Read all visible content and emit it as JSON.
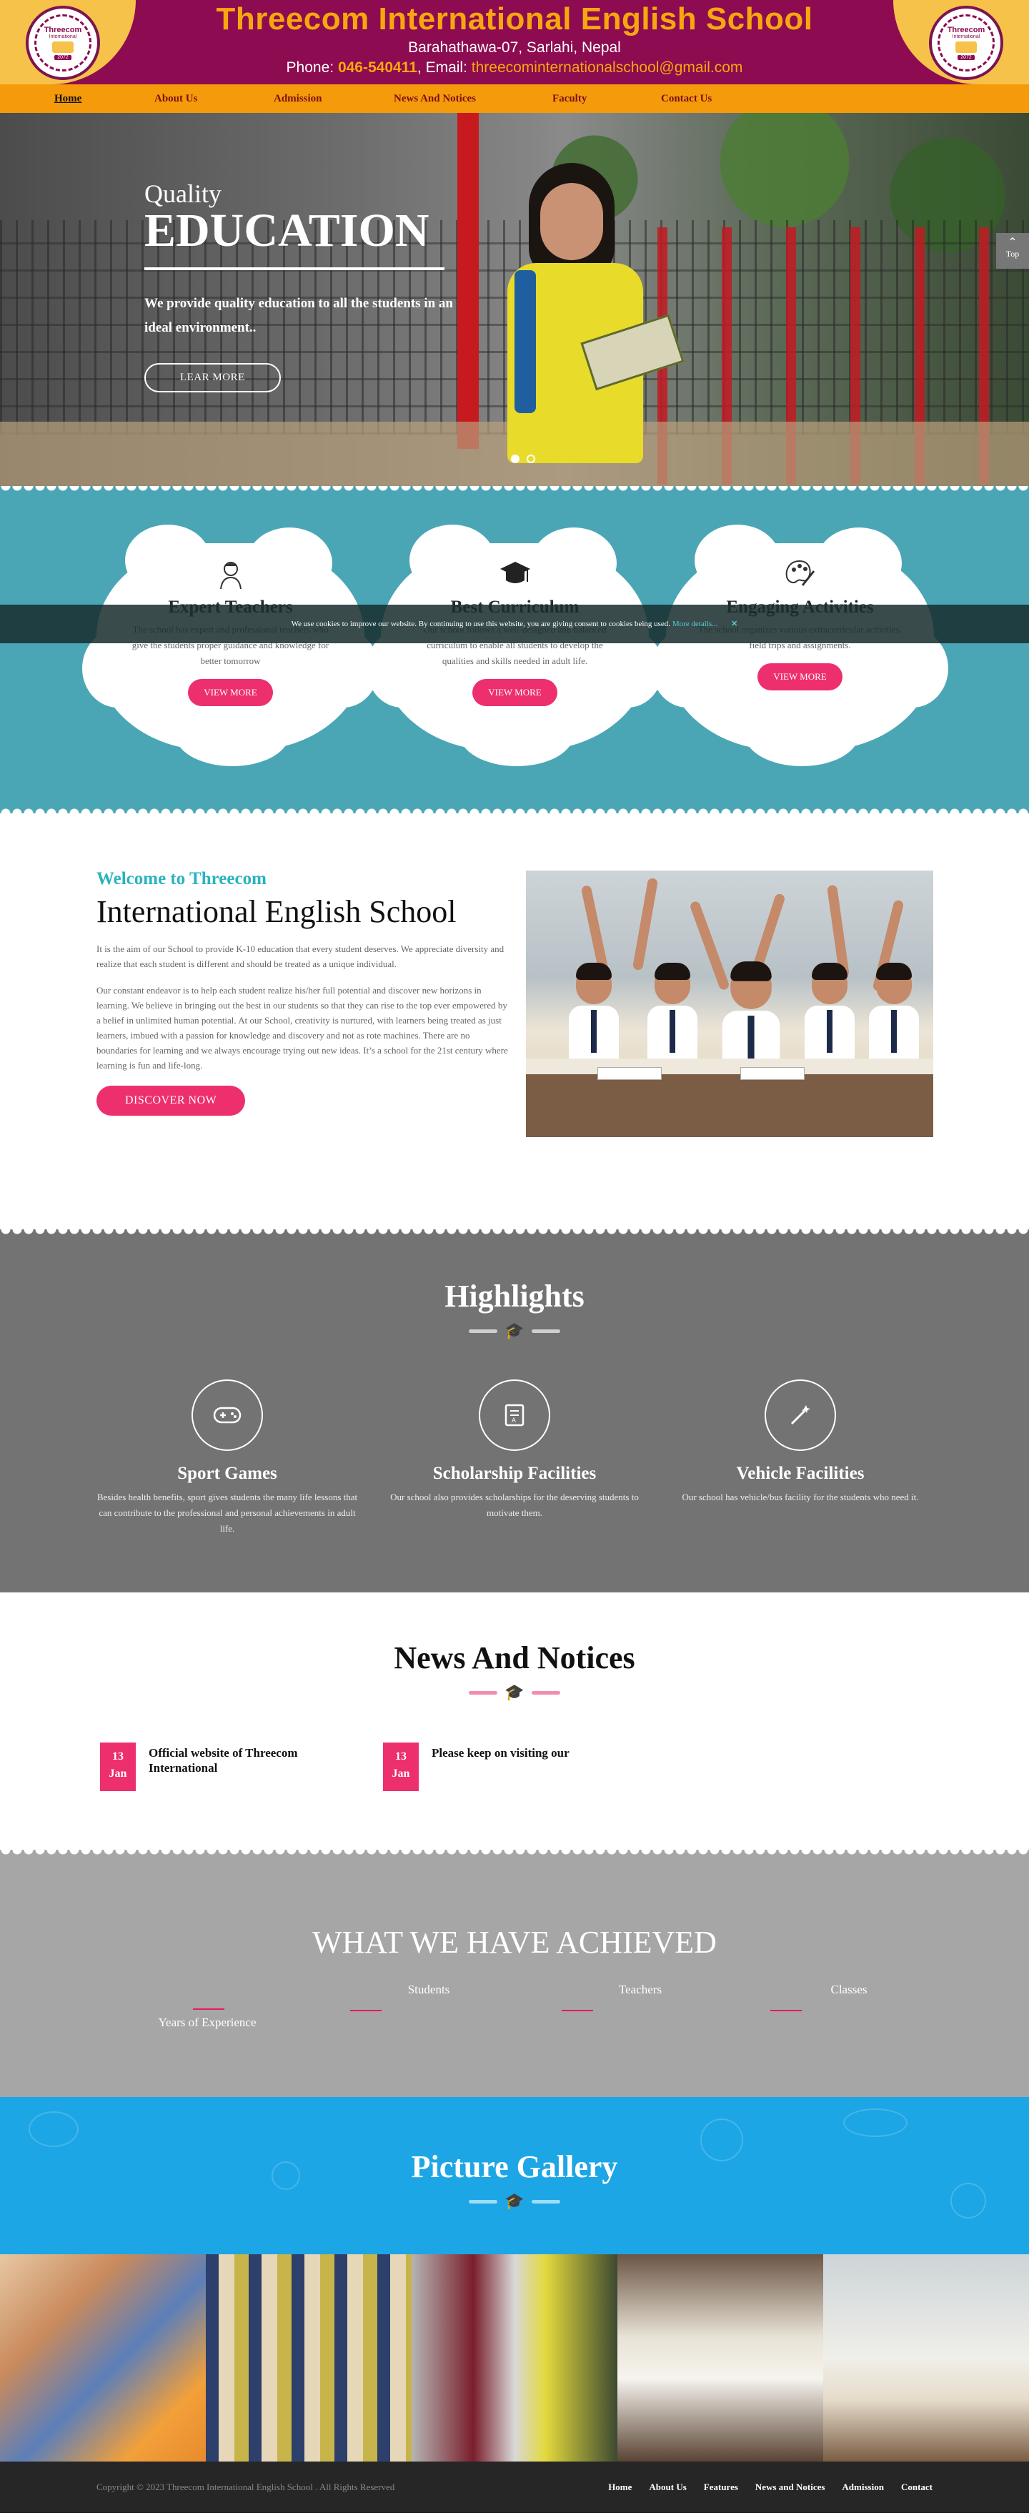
{
  "header": {
    "title": "Threecom International English School",
    "address": "Barahathawa-07, Sarlahi, Nepal",
    "phone_label": "Phone:",
    "phone": "046-540411",
    "email_label": ", Email:",
    "email": "threecominternationalschool@gmail.com",
    "logo_name": "Threecom",
    "logo_sub": "International",
    "logo_year": "2072"
  },
  "nav": [
    {
      "label": "Home",
      "active": true
    },
    {
      "label": "About Us"
    },
    {
      "label": "Admission"
    },
    {
      "label": "News And Notices"
    },
    {
      "label": "Faculty"
    },
    {
      "label": "Contact Us"
    }
  ],
  "hero": {
    "small": "Quality",
    "big": "EDUCATION",
    "desc": "We provide quality education to all the students in an ideal environment..",
    "button": "LEAR MORE",
    "top_label": "Top"
  },
  "cookie": {
    "text": "We use cookies to improve our website. By continuing to use this website, you are giving consent to cookies being used.",
    "more": "More details...",
    "close": "✕"
  },
  "features": [
    {
      "icon": "teacher-icon",
      "title": "Expert Teachers",
      "desc": "The school has expert and professional teachers who give the students proper guidance and knowledge for better tomorrow",
      "button": "VIEW MORE"
    },
    {
      "icon": "graduation-cap-icon",
      "title": "Best Curriculum",
      "desc": "Our school follows a well-designed and balanced curriculum to enable all students to develop the qualities and skills needed in adult life.",
      "button": "VIEW MORE"
    },
    {
      "icon": "palette-icon",
      "title": "Engaging Activities",
      "desc": "The school organizes various extracurricular activities, field trips and assignments.",
      "button": "VIEW MORE"
    }
  ],
  "welcome": {
    "kicker": "Welcome to Threecom",
    "title": "International English School",
    "p1": "It is the aim of our School to provide K-10 education that every student deserves. We appreciate diversity and realize that each student is different and should be treated as a unique individual.",
    "p2": "Our constant endeavor is to help each student realize his/her full potential and discover new horizons in learning. We believe in bringing out the best in our students so that they can rise to the top ever empowered by a belief in unlimited human potential. At our School, creativity is nurtured, with learners being treated as just learners, imbued with a passion for knowledge and discovery and not as rote machines. There are no boundaries for learning and we always encourage trying out new ideas. It’s a school for the 21st century where learning is fun and life-long.",
    "button": "DISCOVER NOW"
  },
  "highlights": {
    "title": "Highlights",
    "items": [
      {
        "icon": "gamepad-icon",
        "title": "Sport Games",
        "desc": "Besides health benefits, sport gives students the many life lessons that can contribute to the professional and personal achievements in adult life."
      },
      {
        "icon": "book-icon",
        "title": "Scholarship Facilities",
        "desc": "Our school also provides scholarships for the deserving students to motivate them."
      },
      {
        "icon": "magic-wand-icon",
        "title": "Vehicle Facilities",
        "desc": "Our school has vehicle/bus facility for the students who need it."
      }
    ]
  },
  "news": {
    "title": "News And Notices",
    "items": [
      {
        "day": "13",
        "month": "Jan",
        "title": "Official website of Threecom International"
      },
      {
        "day": "13",
        "month": "Jan",
        "title": "Please keep on visiting our"
      }
    ]
  },
  "achieved": {
    "title": "WHAT WE HAVE ACHIEVED",
    "stats": [
      "Years of Experience",
      "Students",
      "Teachers",
      "Classes"
    ]
  },
  "gallery": {
    "title": "Picture Gallery"
  },
  "footer": {
    "copyright": "Copyright © 2023 Threecom International English School . All Rights Reserved",
    "links": [
      "Home",
      "About Us",
      "Features",
      "News and Notices",
      "Admission",
      "Contact"
    ]
  },
  "colors": {
    "brand_maroon": "#8d0b50",
    "brand_gold": "#f6a70f",
    "nav_orange": "#f59a0b",
    "accent_pink": "#ee2f6e",
    "teal": "#4aa6b5",
    "gallery_blue": "#1da6e5"
  }
}
